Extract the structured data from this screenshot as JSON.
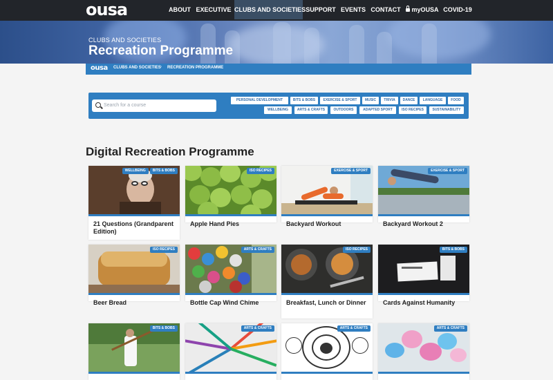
{
  "nav": {
    "logo": "ousa",
    "items": [
      "ABOUT",
      "EXECUTIVE",
      "CLUBS AND SOCIETIES",
      "SUPPORT",
      "EVENTS",
      "CONTACT",
      "myOUSA",
      "COVID-19"
    ]
  },
  "hero": {
    "subtitle": "CLUBS AND SOCIETIES",
    "title": "Recreation Programme"
  },
  "breadcrumb": {
    "logo": "ousa",
    "items": [
      "CLUBS AND SOCIETIES",
      "RECREATION PROGRAMME"
    ],
    "separator": "›"
  },
  "search": {
    "placeholder": "Search for a course"
  },
  "tags": {
    "row1": [
      "PERSONAL DEVELOPMENT",
      "BITS & BOBS",
      "EXERCISE & SPORT",
      "MUSIC",
      "TRIVIA",
      "DANCE",
      "LANGUAGE",
      "FOOD"
    ],
    "row2": [
      "WELLBEING",
      "ARTS & CRAFTS",
      "OUTDOORS",
      "ADAPTED SPORT",
      "ISO RECIPES",
      "SUSTAINABILITY"
    ]
  },
  "section": {
    "title": "Digital Recreation Programme"
  },
  "cards": [
    {
      "title": "21 Questions (Grandparent Edition)",
      "badges": [
        "WELLBEING",
        "BITS & BOBS"
      ]
    },
    {
      "title": "Apple Hand Pies",
      "badges": [
        "ISO RECIPES"
      ]
    },
    {
      "title": "Backyard Workout",
      "badges": [
        "EXERCISE & SPORT"
      ]
    },
    {
      "title": "Backyard Workout 2",
      "badges": [
        "EXERCISE & SPORT"
      ]
    },
    {
      "title": "Beer Bread",
      "badges": [
        "ISO RECIPES"
      ]
    },
    {
      "title": "Bottle Cap Wind Chime",
      "badges": [
        "ARTS & CRAFTS"
      ]
    },
    {
      "title": "Breakfast, Lunch or Dinner",
      "badges": [
        "ISO RECIPES"
      ]
    },
    {
      "title": "Cards Against Humanity",
      "badges": [
        "BITS & BOBS"
      ]
    },
    {
      "title": "",
      "badges": [
        "BITS & BOBS"
      ]
    },
    {
      "title": "",
      "badges": [
        "ARTS & CRAFTS"
      ]
    },
    {
      "title": "",
      "badges": [
        "ARTS & CRAFTS"
      ]
    },
    {
      "title": "",
      "badges": [
        "ARTS & CRAFTS"
      ]
    }
  ],
  "colors": {
    "nav_bg": "#22252a",
    "accent": "#2f7ec1",
    "page_bg": "#f4f4f4"
  }
}
